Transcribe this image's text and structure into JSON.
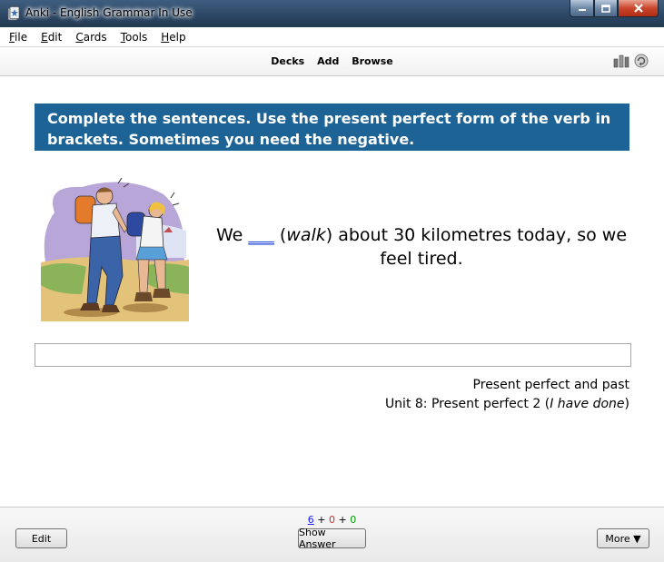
{
  "window": {
    "title": "Anki - English Grammar In Use"
  },
  "menu": {
    "items": [
      {
        "key": "F",
        "rest": "ile"
      },
      {
        "key": "E",
        "rest": "dit"
      },
      {
        "key": "C",
        "rest": "ards"
      },
      {
        "key": "T",
        "rest": "ools"
      },
      {
        "key": "H",
        "rest": "elp"
      }
    ]
  },
  "toolbar": {
    "decks": "Decks",
    "add": "Add",
    "browse": "Browse"
  },
  "card": {
    "instructions": "Complete the sentences. Use the present perfect form of the verb in brackets. Sometimes you need the negative.",
    "question": {
      "before": "We ",
      "blank": "___",
      "middle": " (",
      "verb": "walk",
      "after": ") about 30 kilometres today, so we feel tired."
    },
    "source": {
      "line1": "Present perfect and past",
      "line2_before": "Unit 8: Present perfect 2 (",
      "line2_italic": "I have done",
      "line2_after": ")"
    }
  },
  "counts": {
    "new": "6",
    "plus1": " + ",
    "learning": "0",
    "plus2": " + ",
    "review": "0"
  },
  "buttons": {
    "edit": "Edit",
    "show_answer": "Show Answer",
    "more": "More ▼"
  }
}
